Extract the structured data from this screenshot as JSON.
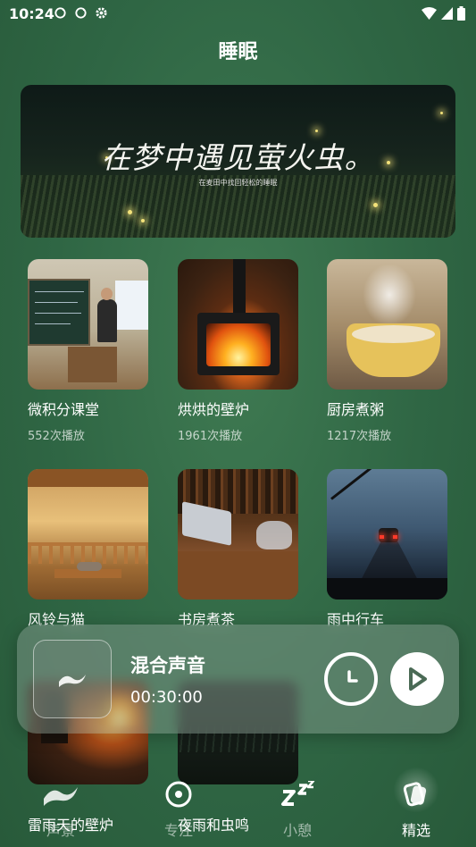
{
  "status_bar": {
    "time": "10:24"
  },
  "header": {
    "title": "睡眠"
  },
  "banner": {
    "headline": "在梦中遇见萤火虫。",
    "subtitle": "在麦田中找回轻松的睡眠"
  },
  "cards": [
    {
      "title": "微积分课堂",
      "plays": "552次播放"
    },
    {
      "title": "烘烘的壁炉",
      "plays": "1961次播放"
    },
    {
      "title": "厨房煮粥",
      "plays": "1217次播放"
    },
    {
      "title": "风铃与猫",
      "plays": ""
    },
    {
      "title": "书房煮茶",
      "plays": ""
    },
    {
      "title": "雨中行车",
      "plays": ""
    },
    {
      "title": "雷雨天的壁炉",
      "plays": ""
    },
    {
      "title": "夜雨和虫鸣",
      "plays": ""
    }
  ],
  "player": {
    "title": "混合声音",
    "duration": "00:30:00"
  },
  "bottom_nav": {
    "items": [
      {
        "label": "声景",
        "icon": "wave-icon",
        "active": false
      },
      {
        "label": "专注",
        "icon": "target-icon",
        "active": false
      },
      {
        "label": "小憩",
        "icon": "zzz-icon",
        "active": false
      },
      {
        "label": "精选",
        "icon": "cards-icon",
        "active": true
      }
    ]
  }
}
